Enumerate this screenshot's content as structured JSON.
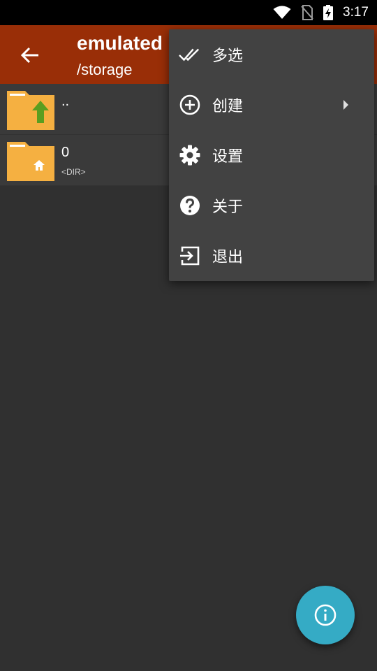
{
  "status_bar": {
    "time": "3:17",
    "icons": [
      "wifi-icon",
      "no-sim-icon",
      "battery-charging-icon"
    ]
  },
  "app_bar": {
    "back_icon": "arrow-back-icon",
    "title": "emulated",
    "subtitle": "/storage",
    "color": "#992e07"
  },
  "files": [
    {
      "name": "..",
      "meta": "",
      "icon": "folder-up-icon"
    },
    {
      "name": "0",
      "meta": "<DIR>",
      "icon": "folder-home-icon"
    }
  ],
  "menu": {
    "items": [
      {
        "label": "多选",
        "icon": "double-check-icon"
      },
      {
        "label": "创建",
        "icon": "add-circle-icon",
        "has_submenu": true
      },
      {
        "label": "设置",
        "icon": "gear-icon"
      },
      {
        "label": "关于",
        "icon": "help-circle-icon"
      },
      {
        "label": "退出",
        "icon": "exit-icon"
      }
    ]
  },
  "fab": {
    "icon": "info-icon",
    "color": "#35abc5"
  }
}
